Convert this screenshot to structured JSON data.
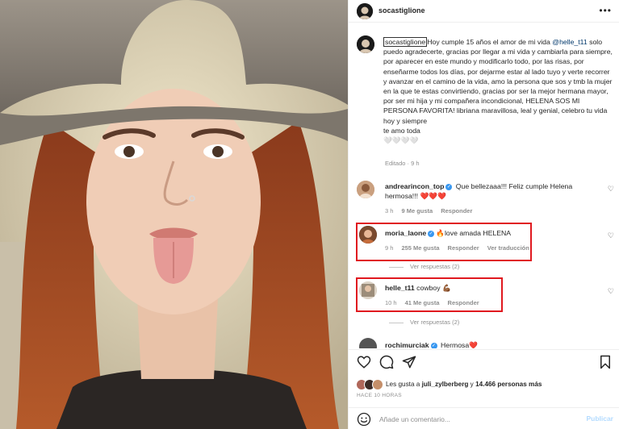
{
  "post": {
    "author": "socastiglione",
    "more_icon": "ellipsis-icon"
  },
  "caption": {
    "user": "socastiglione",
    "text_before_mention": "Hoy cumple 15 años el amor de mi vida ",
    "mention": "@helle_t11",
    "text_after_mention": " solo puedo agradecerte, gracias por llegar a mi vida y cambiarla para siempre, por aparecer en este mundo y modificarlo todo, por las risas, por enseñarme todos los días, por dejarme estar al lado tuyo y verte recorrer y avanzar en el camino de la vida, amo la persona que sos y tmb la mujer en la que te estas convirtiendo, gracias por ser la mejor hermana mayor, por ser mi hija y mi compañera incondicional, HELENA SOS MI PERSONA FAVORITA! libriana maravillosa, leal y genial, celebro tu vida hoy y siempre",
    "closing": "te amo toda",
    "emojis": "🤍🤍🤍🤍",
    "edited": "Editado · 9 h"
  },
  "comments": [
    {
      "user": "andrearincon_top",
      "text": "Que bellezaaa!!! Feliz cumple Helena hermosa!!! ❤️❤️❤️",
      "time": "3 h",
      "likes": "9 Me gusta",
      "reply": "Responder"
    },
    {
      "user": "moria_laone",
      "text": "🔥love amada HELENA",
      "time": "9 h",
      "likes": "255 Me gusta",
      "reply": "Responder",
      "translate": "Ver traducción",
      "view_replies": "Ver respuestas (2)"
    },
    {
      "user": "helle_t11",
      "text": "cowboy 💪🏾",
      "time": "10 h",
      "likes": "41 Me gusta",
      "reply": "Responder",
      "view_replies": "Ver respuestas (2)"
    },
    {
      "user": "rochimurciak",
      "text": "Hermosa❤️"
    }
  ],
  "actions": {
    "like_icon": "heart-icon",
    "comment_icon": "comment-icon",
    "share_icon": "paper-plane-icon",
    "save_icon": "bookmark-icon",
    "likes_prefix": "Les gusta a ",
    "likes_user": "juli_zylberberg",
    "likes_middle": " y ",
    "likes_count": "14.466 personas más",
    "time_ago": "HACE 10 HORAS"
  },
  "composer": {
    "placeholder": "Añade un comentario...",
    "publish": "Publicar",
    "emoji_icon": "smiley-icon"
  },
  "colors": {
    "highlight_box": "#e0191f",
    "verified": "#3897f0",
    "link": "#00376b",
    "muted": "#8e8e8e"
  }
}
